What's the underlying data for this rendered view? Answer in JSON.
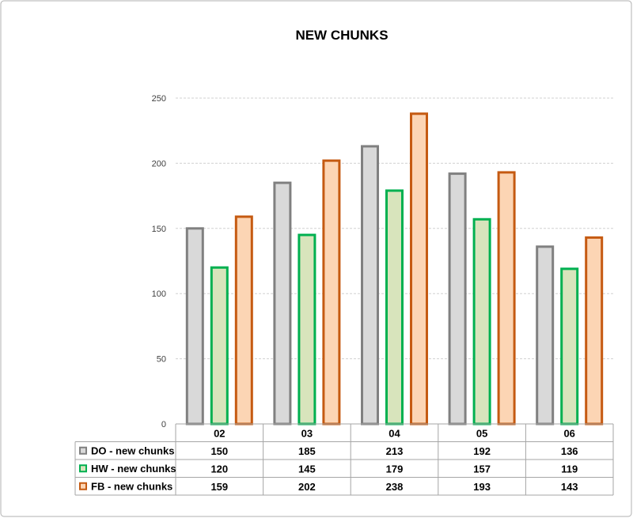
{
  "chart_data": {
    "type": "bar",
    "title": "NEW CHUNKS",
    "categories": [
      "02",
      "03",
      "04",
      "05",
      "06"
    ],
    "series": [
      {
        "name": "DO - new chunks",
        "values": [
          150,
          185,
          213,
          192,
          136
        ],
        "fill": "#d9d9d9",
        "stroke": "#808080"
      },
      {
        "name": "HW - new chunks",
        "values": [
          120,
          145,
          179,
          157,
          119
        ],
        "fill": "#d8e4bc",
        "stroke": "#00b050"
      },
      {
        "name": "FB - new chunks",
        "values": [
          159,
          202,
          238,
          193,
          143
        ],
        "fill": "#fcd5b4",
        "stroke": "#c55a11"
      }
    ],
    "y_ticks": [
      "0",
      "50",
      "100",
      "150",
      "200",
      "250"
    ],
    "ylim": [
      0,
      250
    ],
    "grid": true,
    "legend": "data-table-below"
  }
}
